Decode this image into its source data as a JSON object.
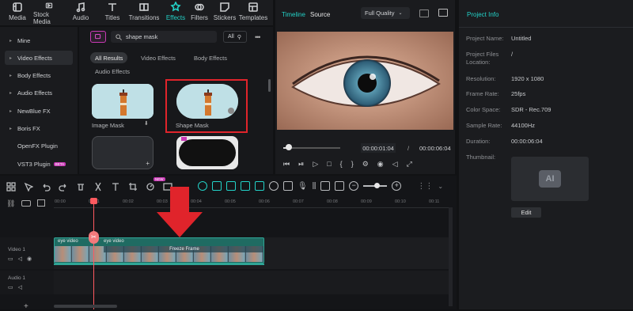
{
  "toolbar": {
    "items": [
      {
        "label": "Media"
      },
      {
        "label": "Stock Media"
      },
      {
        "label": "Audio"
      },
      {
        "label": "Titles"
      },
      {
        "label": "Transitions"
      },
      {
        "label": "Effects"
      },
      {
        "label": "Filters"
      },
      {
        "label": "Stickers"
      },
      {
        "label": "Templates"
      }
    ],
    "active": "Effects"
  },
  "sidebar": {
    "items": [
      {
        "label": "Mine"
      },
      {
        "label": "Video Effects"
      },
      {
        "label": "Body Effects"
      },
      {
        "label": "Audio Effects"
      },
      {
        "label": "NewBlue FX"
      },
      {
        "label": "Boris FX"
      },
      {
        "label": "OpenFX Plugin"
      },
      {
        "label": "VST3 Plugin",
        "badge": "BETA"
      }
    ],
    "active": "Video Effects"
  },
  "library": {
    "search_value": "shape mask",
    "filter_label": "All",
    "tabs": [
      {
        "label": "All Results"
      },
      {
        "label": "Video Effects"
      },
      {
        "label": "Body Effects"
      },
      {
        "label": "Audio Effects"
      }
    ],
    "active_tab": "All Results",
    "results": [
      {
        "label": "Image Mask"
      },
      {
        "label": "Shape Mask"
      }
    ],
    "highlight_color": "#e0242b"
  },
  "preview": {
    "tab_timeline": "Timeline",
    "tab_source": "Source",
    "quality": "Full Quality",
    "current_time": "00:00:01:04",
    "separator": "/",
    "total_time": "00:00:06:04",
    "progress": 0.1
  },
  "project": {
    "header": "Project Info",
    "fields": [
      {
        "label": "Project Name:",
        "value": "Untitled"
      },
      {
        "label": "Project Files Location:",
        "value": "/"
      },
      {
        "label": "Resolution:",
        "value": "1920 x 1080"
      },
      {
        "label": "Frame Rate:",
        "value": "25fps"
      },
      {
        "label": "Color Space:",
        "value": "SDR - Rec.709"
      },
      {
        "label": "Sample Rate:",
        "value": "44100Hz"
      },
      {
        "label": "Duration:",
        "value": "00:00:06:04"
      }
    ],
    "thumbnail_label": "Thumbnail:",
    "thumb_text": "AI",
    "edit_label": "Edit"
  },
  "timeline": {
    "ruler": [
      "00:00",
      "00:01",
      "00:02",
      "00:03",
      "00:04",
      "00:05",
      "00:06",
      "00:07",
      "00:08",
      "00:09",
      "00:10",
      "00:11"
    ],
    "track_video": "Video 1",
    "track_audio": "Audio 1",
    "clip1": "eye video",
    "clip2": "eye video",
    "freeze": "Freeze Frame",
    "new_badge": "NEW"
  },
  "accent": "#23d2c8",
  "arrow_color": "#e0242b"
}
